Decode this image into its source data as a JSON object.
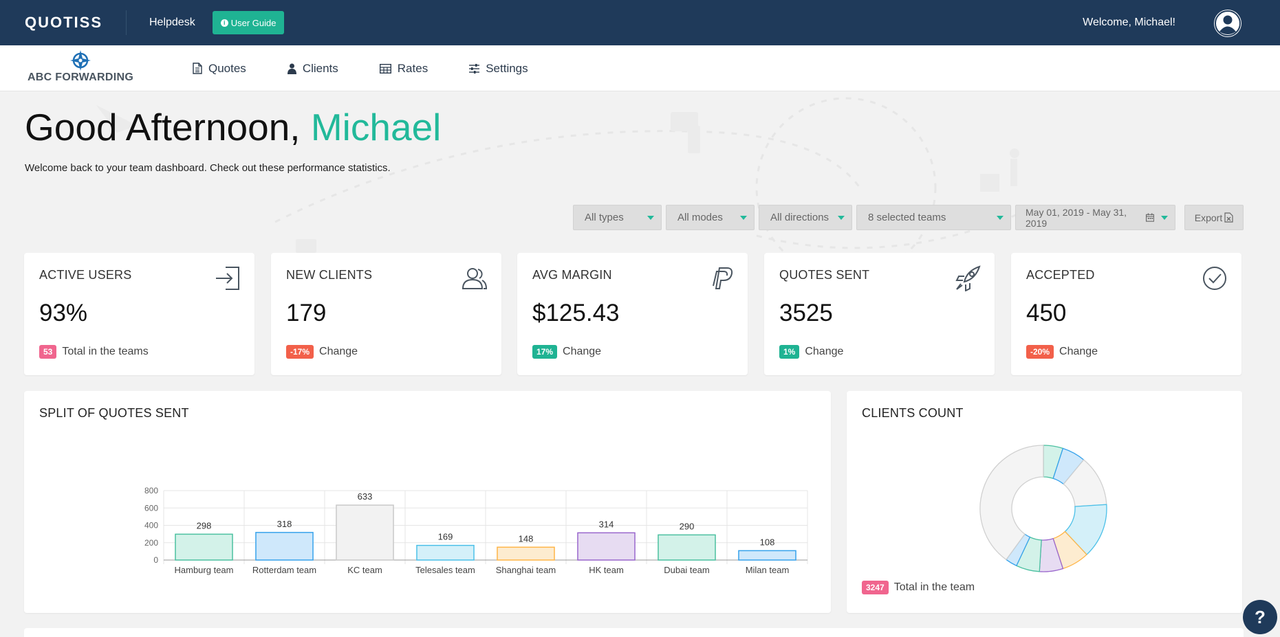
{
  "topbar": {
    "brand": "QUOTISS",
    "helpdesk": "Helpdesk",
    "guide_label": "User Guide",
    "welcome": "Welcome, Michael!"
  },
  "navbar": {
    "company": "ABC FORWARDING",
    "items": [
      {
        "label": "Quotes",
        "icon": "document-icon"
      },
      {
        "label": "Clients",
        "icon": "user-icon"
      },
      {
        "label": "Rates",
        "icon": "table-icon"
      },
      {
        "label": "Settings",
        "icon": "sliders-icon"
      }
    ]
  },
  "greeting": {
    "prefix": "Good Afternoon,",
    "name": "Michael",
    "subtitle": "Welcome back to your team dashboard. Check out these performance statistics."
  },
  "filters": {
    "types": "All types",
    "modes": "All modes",
    "directions": "All directions",
    "teams": "8 selected teams",
    "date_range": "May 01, 2019 - May 31, 2019",
    "export": "Export"
  },
  "stats": [
    {
      "title": "ACTIVE USERS",
      "value": "93%",
      "badge": "53",
      "badge_color": "#f0658e",
      "foot": "Total in the teams",
      "icon": "sign-in-icon"
    },
    {
      "title": "NEW CLIENTS",
      "value": "179",
      "badge": "-17%",
      "badge_color": "#f2604a",
      "foot": "Change",
      "icon": "users-icon"
    },
    {
      "title": "AVG MARGIN",
      "value": "$125.43",
      "badge": "17%",
      "badge_color": "#1fb393",
      "foot": "Change",
      "icon": "paypal-icon"
    },
    {
      "title": "QUOTES SENT",
      "value": "3525",
      "badge": "1%",
      "badge_color": "#1fb393",
      "foot": "Change",
      "icon": "rocket-icon"
    },
    {
      "title": "ACCEPTED",
      "value": "450",
      "badge": "-20%",
      "badge_color": "#f2604a",
      "foot": "Change",
      "icon": "check-circle-icon"
    }
  ],
  "split": {
    "title": "SPLIT OF QUOTES SENT"
  },
  "clients": {
    "title": "CLIENTS COUNT",
    "badge": "3247",
    "badge_color": "#f0658e",
    "foot": "Total in the team"
  },
  "help": "?",
  "chart_data": [
    {
      "type": "bar",
      "title": "SPLIT OF QUOTES SENT",
      "categories": [
        "Hamburg team",
        "Rotterdam  team",
        "KC  team",
        "Telesales  team",
        "Shanghai  team",
        "HK team",
        "Dubai team",
        "Milan team"
      ],
      "values": [
        298,
        318,
        633,
        169,
        148,
        314,
        290,
        108
      ],
      "colors": [
        "#4bc0a0",
        "#36a2eb",
        "#c9c9c9",
        "#4bc0e8",
        "#ffb547",
        "#9966cc",
        "#4bc0a0",
        "#36a2eb"
      ],
      "fills": [
        "#d3f2e9",
        "#cfe8fb",
        "#f2f2f2",
        "#d4f0f9",
        "#fdecd0",
        "#e7dcf2",
        "#d3f2e9",
        "#cfe8fb"
      ],
      "ylim": [
        0,
        800
      ],
      "yticks": [
        0,
        200,
        400,
        600,
        800
      ],
      "grid": true,
      "xlabel": "",
      "ylabel": ""
    },
    {
      "type": "pie",
      "title": "CLIENTS COUNT",
      "donut": true,
      "values": [
        5,
        6,
        13,
        14,
        7,
        6,
        6,
        3,
        40
      ],
      "colors": [
        "#4bc0a0",
        "#36a2eb",
        "#d0d0d0",
        "#4bc0e8",
        "#ffb547",
        "#9966cc",
        "#4bc0a0",
        "#36a2eb",
        "#d0d0d0"
      ],
      "fills": [
        "#d3f2e9",
        "#cfe8fb",
        "#f4f4f4",
        "#d4f0f9",
        "#fdecd0",
        "#e7dcf2",
        "#d3f2e9",
        "#cfe8fb",
        "#f4f4f4"
      ]
    }
  ]
}
